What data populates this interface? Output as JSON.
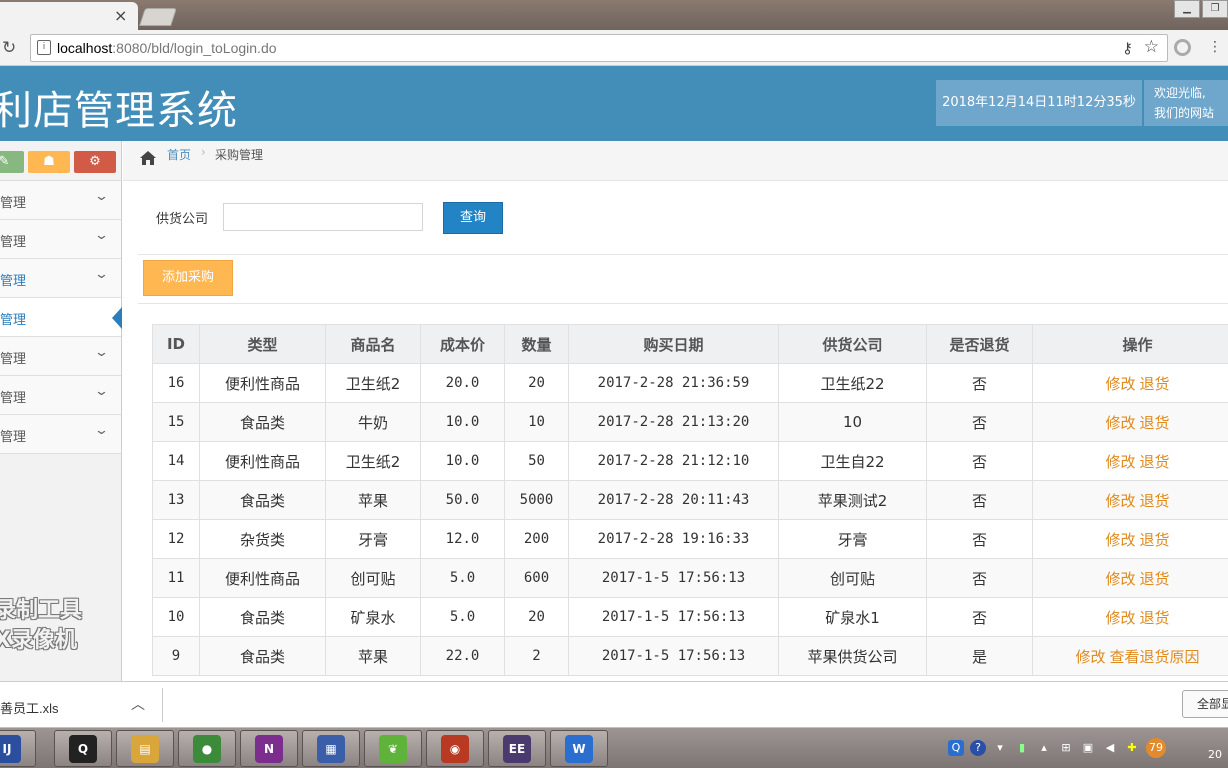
{
  "browser": {
    "tab_close": "×",
    "url_host": "localhost",
    "url_rest": ":8080/bld/login_toLogin.do"
  },
  "header": {
    "title": "利店管理系统",
    "datetime": "2018年12月14日11时12分35秒",
    "welcome_line1": "欢迎光临,",
    "welcome_line2": "我们的网站",
    "color": "#438eb9"
  },
  "sidebar": {
    "items": [
      {
        "label": "管理",
        "active": false
      },
      {
        "label": "管理",
        "active": false
      },
      {
        "label": "管理",
        "active": false
      },
      {
        "label": "管理",
        "active": true
      },
      {
        "label": "管理",
        "active": false
      },
      {
        "label": "管理",
        "active": false
      },
      {
        "label": "管理",
        "active": false
      }
    ],
    "watermark_line1": "录制工具",
    "watermark_line2": "X录像机"
  },
  "breadcrumb": {
    "home": "首页",
    "current": "采购管理"
  },
  "search": {
    "label": "供货公司",
    "value": "",
    "button": "查询"
  },
  "toolbar": {
    "add_label": "添加采购"
  },
  "table": {
    "headers": [
      "ID",
      "类型",
      "商品名",
      "成本价",
      "数量",
      "购买日期",
      "供货公司",
      "是否退货",
      "操作"
    ],
    "rows": [
      {
        "id": "16",
        "type": "便利性商品",
        "name": "卫生纸2",
        "cost": "20.0",
        "qty": "20",
        "date": "2017-2-28 21:36:59",
        "supplier": "卫生纸22",
        "returned": "否",
        "ops": [
          "修改",
          "退货"
        ]
      },
      {
        "id": "15",
        "type": "食品类",
        "name": "牛奶",
        "cost": "10.0",
        "qty": "10",
        "date": "2017-2-28 21:13:20",
        "supplier": "10",
        "returned": "否",
        "ops": [
          "修改",
          "退货"
        ]
      },
      {
        "id": "14",
        "type": "便利性商品",
        "name": "卫生纸2",
        "cost": "10.0",
        "qty": "50",
        "date": "2017-2-28 21:12:10",
        "supplier": "卫生自22",
        "returned": "否",
        "ops": [
          "修改",
          "退货"
        ]
      },
      {
        "id": "13",
        "type": "食品类",
        "name": "苹果",
        "cost": "50.0",
        "qty": "5000",
        "date": "2017-2-28 20:11:43",
        "supplier": "苹果测试2",
        "returned": "否",
        "ops": [
          "修改",
          "退货"
        ]
      },
      {
        "id": "12",
        "type": "杂货类",
        "name": "牙膏",
        "cost": "12.0",
        "qty": "200",
        "date": "2017-2-28 19:16:33",
        "supplier": "牙膏",
        "returned": "否",
        "ops": [
          "修改",
          "退货"
        ]
      },
      {
        "id": "11",
        "type": "便利性商品",
        "name": "创可贴",
        "cost": "5.0",
        "qty": "600",
        "date": "2017-1-5 17:56:13",
        "supplier": "创可贴",
        "returned": "否",
        "ops": [
          "修改",
          "退货"
        ]
      },
      {
        "id": "10",
        "type": "食品类",
        "name": "矿泉水",
        "cost": "5.0",
        "qty": "20",
        "date": "2017-1-5 17:56:13",
        "supplier": "矿泉水1",
        "returned": "否",
        "ops": [
          "修改",
          "退货"
        ]
      },
      {
        "id": "9",
        "type": "食品类",
        "name": "苹果",
        "cost": "22.0",
        "qty": "2",
        "date": "2017-1-5 17:56:13",
        "supplier": "苹果供货公司",
        "returned": "是",
        "ops": [
          "修改",
          "查看退货原因"
        ]
      }
    ]
  },
  "downloads": {
    "file": "善员工.xls",
    "show_all": "全部显"
  },
  "taskbar": {
    "apps": [
      {
        "icon": "intellij-icon",
        "glyph": "IJ",
        "color": "#2b4f9e"
      },
      {
        "icon": "qq-icon",
        "glyph": "Q",
        "color": "#222"
      },
      {
        "icon": "file-explorer-icon",
        "glyph": "▤",
        "color": "#d8a63a"
      },
      {
        "icon": "chrome-icon",
        "glyph": "●",
        "color": "#3b8b3b"
      },
      {
        "icon": "onenote-icon",
        "glyph": "N",
        "color": "#7b2e8e"
      },
      {
        "icon": "screen-capture-icon",
        "glyph": "▦",
        "color": "#3a5ea8"
      },
      {
        "icon": "leaf-app-icon",
        "glyph": "❦",
        "color": "#5fb33a"
      },
      {
        "icon": "ninja-app-icon",
        "glyph": "◉",
        "color": "#b83a22"
      },
      {
        "icon": "java-ee-ide-icon",
        "glyph": "EE",
        "color": "#4a3a6e"
      },
      {
        "icon": "wps-icon",
        "glyph": "W",
        "color": "#2a6fd0"
      }
    ],
    "tray_badge": "79",
    "clock": "20"
  }
}
